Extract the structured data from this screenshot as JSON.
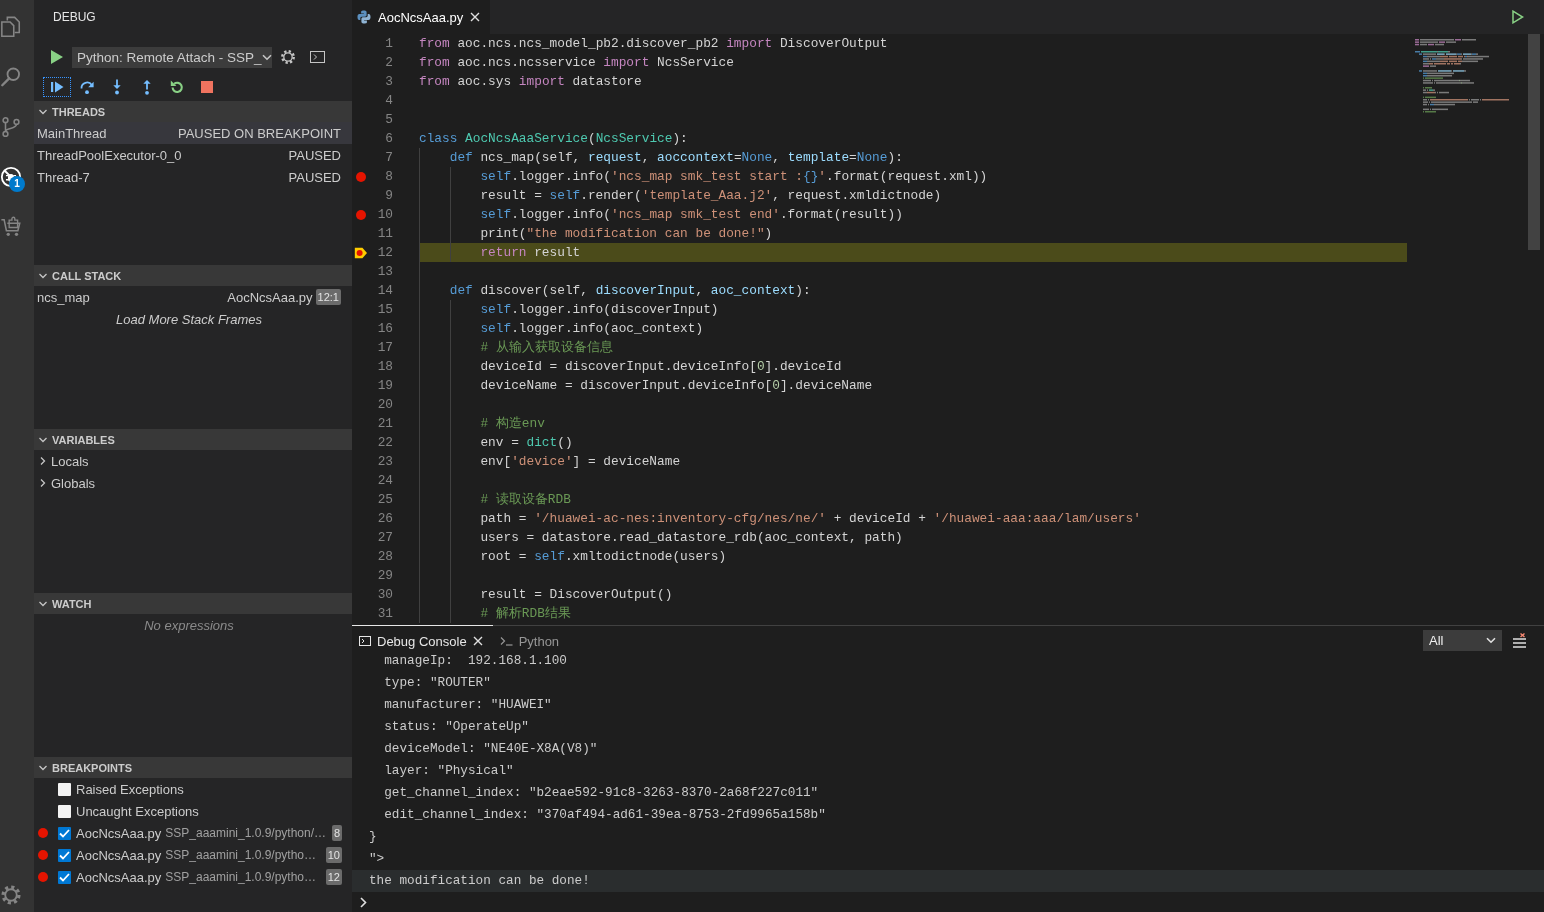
{
  "activity_bar": {
    "items": [
      {
        "kind": "explorer",
        "selected": false
      },
      {
        "kind": "search",
        "selected": false
      },
      {
        "kind": "source-control",
        "selected": false
      },
      {
        "kind": "debug",
        "selected": true,
        "badge": "1"
      },
      {
        "kind": "extensions",
        "selected": false
      }
    ],
    "bottom": [
      {
        "kind": "settings"
      }
    ]
  },
  "sidebar": {
    "title": "DEBUG",
    "config": {
      "value": "Python: Remote Attach - SSP_"
    },
    "toolbar": [
      {
        "kind": "continue",
        "focused": true
      },
      {
        "kind": "step-over",
        "focused": false
      },
      {
        "kind": "step-into",
        "focused": false
      },
      {
        "kind": "step-out",
        "focused": false
      },
      {
        "kind": "restart",
        "focused": false
      },
      {
        "kind": "stop",
        "focused": false
      }
    ],
    "sections": [
      {
        "kind": "threads",
        "title": "THREADS",
        "expanded": true,
        "threads": [
          {
            "name": "MainThread",
            "status": "PAUSED ON BREAKPOINT",
            "selected": true
          },
          {
            "name": "ThreadPoolExecutor-0_0",
            "status": "PAUSED",
            "selected": false
          },
          {
            "name": "Thread-7",
            "status": "PAUSED",
            "selected": false
          }
        ]
      },
      {
        "kind": "call-stack",
        "title": "CALL STACK",
        "expanded": true,
        "frames": [
          {
            "name": "ncs_map",
            "file": "AocNcsAaa.py",
            "position": "12:1"
          }
        ],
        "load_more": "Load More Stack Frames"
      },
      {
        "kind": "variables",
        "title": "VARIABLES",
        "expanded": true,
        "scopes": [
          {
            "label": "Locals",
            "expanded": false
          },
          {
            "label": "Globals",
            "expanded": false
          }
        ]
      },
      {
        "kind": "watch",
        "title": "WATCH",
        "expanded": true,
        "empty_message": "No expressions"
      },
      {
        "kind": "breakpoints",
        "title": "BREAKPOINTS",
        "expanded": true,
        "breakpoints": [
          {
            "kind": "exception",
            "label": "Raised Exceptions",
            "checked": false
          },
          {
            "kind": "exception",
            "label": "Uncaught Exceptions",
            "checked": false
          },
          {
            "kind": "file",
            "label": "AocNcsAaa.py",
            "path": "SSP_aaamini_1.0.9/python/…",
            "line": "8",
            "checked": true
          },
          {
            "kind": "file",
            "label": "AocNcsAaa.py",
            "path": "SSP_aaamini_1.0.9/pytho…",
            "line": "10",
            "checked": true
          },
          {
            "kind": "file",
            "label": "AocNcsAaa.py",
            "path": "SSP_aaamini_1.0.9/pytho…",
            "line": "12",
            "checked": true
          }
        ]
      }
    ]
  },
  "editor": {
    "tabs": [
      {
        "label": "AocNcsAaa.py",
        "selected": true
      }
    ],
    "lines": [
      {
        "number": "1",
        "breakpoint": false,
        "current": false,
        "tokens": [
          {
            "kind": "keyword",
            "text": "from"
          },
          {
            "kind": "plain",
            "text": " aoc.ncs.ncs_model_pb2.discover_pb2 "
          },
          {
            "kind": "keyword",
            "text": "import"
          },
          {
            "kind": "plain",
            "text": " DiscoverOutput"
          }
        ]
      },
      {
        "number": "2",
        "breakpoint": false,
        "current": false,
        "tokens": [
          {
            "kind": "keyword",
            "text": "from"
          },
          {
            "kind": "plain",
            "text": " aoc.ncs.ncsservice "
          },
          {
            "kind": "keyword",
            "text": "import"
          },
          {
            "kind": "plain",
            "text": " NcsService"
          }
        ]
      },
      {
        "number": "3",
        "breakpoint": false,
        "current": false,
        "tokens": [
          {
            "kind": "keyword",
            "text": "from"
          },
          {
            "kind": "plain",
            "text": " aoc.sys "
          },
          {
            "kind": "keyword",
            "text": "import"
          },
          {
            "kind": "plain",
            "text": " datastore"
          }
        ]
      },
      {
        "number": "4",
        "breakpoint": false,
        "current": false
      },
      {
        "number": "5",
        "breakpoint": false,
        "current": false
      },
      {
        "number": "6",
        "breakpoint": false,
        "current": false,
        "tokens": [
          {
            "kind": "storage",
            "text": "class "
          },
          {
            "kind": "type",
            "text": "AocNcsAaaService"
          },
          {
            "kind": "plain",
            "text": "("
          },
          {
            "kind": "type",
            "text": "NcsService"
          },
          {
            "kind": "plain",
            "text": "):"
          }
        ],
        "children": [
          {
            "number": "7",
            "breakpoint": false,
            "current": false,
            "tokens": [
              {
                "kind": "storage",
                "text": "def"
              },
              {
                "kind": "plain",
                "text": " ncs_map(self, "
              },
              {
                "kind": "param",
                "text": "request"
              },
              {
                "kind": "plain",
                "text": ", "
              },
              {
                "kind": "param",
                "text": "aoccontext"
              },
              {
                "kind": "plain",
                "text": "="
              },
              {
                "kind": "storage",
                "text": "None"
              },
              {
                "kind": "plain",
                "text": ", "
              },
              {
                "kind": "param",
                "text": "template"
              },
              {
                "kind": "plain",
                "text": "="
              },
              {
                "kind": "storage",
                "text": "None"
              },
              {
                "kind": "plain",
                "text": "):"
              }
            ],
            "children": [
              {
                "number": "8",
                "breakpoint": true,
                "current": false,
                "tokens": [
                  {
                    "kind": "storage",
                    "text": "self"
                  },
                  {
                    "kind": "plain",
                    "text": ".logger.info("
                  },
                  {
                    "kind": "string",
                    "text": "'ncs_map smk_test start :"
                  },
                  {
                    "kind": "format",
                    "text": "{}"
                  },
                  {
                    "kind": "string",
                    "text": "'"
                  },
                  {
                    "kind": "plain",
                    "text": ".format(request.xml))"
                  }
                ]
              },
              {
                "number": "9",
                "breakpoint": false,
                "current": false,
                "tokens": [
                  {
                    "kind": "plain",
                    "text": "result = "
                  },
                  {
                    "kind": "storage",
                    "text": "self"
                  },
                  {
                    "kind": "plain",
                    "text": ".render("
                  },
                  {
                    "kind": "string",
                    "text": "'template_Aaa.j2'"
                  },
                  {
                    "kind": "plain",
                    "text": ", request.xmldictnode)"
                  }
                ]
              },
              {
                "number": "10",
                "breakpoint": true,
                "current": false,
                "tokens": [
                  {
                    "kind": "storage",
                    "text": "self"
                  },
                  {
                    "kind": "plain",
                    "text": ".logger.info("
                  },
                  {
                    "kind": "string",
                    "text": "'ncs_map smk_test end'"
                  },
                  {
                    "kind": "plain",
                    "text": ".format(result))"
                  }
                ]
              },
              {
                "number": "11",
                "breakpoint": false,
                "current": false,
                "tokens": [
                  {
                    "kind": "plain",
                    "text": "print("
                  },
                  {
                    "kind": "string",
                    "text": "\"the modification can be done!\""
                  },
                  {
                    "kind": "plain",
                    "text": ")"
                  }
                ]
              },
              {
                "number": "12",
                "breakpoint": true,
                "current": true,
                "tokens": [
                  {
                    "kind": "keyword",
                    "text": "return"
                  },
                  {
                    "kind": "plain",
                    "text": " result"
                  }
                ]
              }
            ]
          },
          {
            "number": "13",
            "breakpoint": false,
            "current": false
          },
          {
            "number": "14",
            "breakpoint": false,
            "current": false,
            "tokens": [
              {
                "kind": "storage",
                "text": "def"
              },
              {
                "kind": "plain",
                "text": " discover(self, "
              },
              {
                "kind": "param",
                "text": "discoverInput"
              },
              {
                "kind": "plain",
                "text": ", "
              },
              {
                "kind": "param",
                "text": "aoc_context"
              },
              {
                "kind": "plain",
                "text": "):"
              }
            ],
            "children": [
              {
                "number": "15",
                "breakpoint": false,
                "current": false,
                "tokens": [
                  {
                    "kind": "storage",
                    "text": "self"
                  },
                  {
                    "kind": "plain",
                    "text": ".logger.info(discoverInput)"
                  }
                ]
              },
              {
                "number": "16",
                "breakpoint": false,
                "current": false,
                "tokens": [
                  {
                    "kind": "storage",
                    "text": "self"
                  },
                  {
                    "kind": "plain",
                    "text": ".logger.info(aoc_context)"
                  }
                ]
              },
              {
                "number": "17",
                "breakpoint": false,
                "current": false,
                "tokens": [
                  {
                    "kind": "comment",
                    "text": "# 从输入获取设备信息"
                  }
                ]
              },
              {
                "number": "18",
                "breakpoint": false,
                "current": false,
                "tokens": [
                  {
                    "kind": "plain",
                    "text": "deviceId = discoverInput.deviceInfo["
                  },
                  {
                    "kind": "number",
                    "text": "0"
                  },
                  {
                    "kind": "plain",
                    "text": "].deviceId"
                  }
                ]
              },
              {
                "number": "19",
                "breakpoint": false,
                "current": false,
                "tokens": [
                  {
                    "kind": "plain",
                    "text": "deviceName = discoverInput.deviceInfo["
                  },
                  {
                    "kind": "number",
                    "text": "0"
                  },
                  {
                    "kind": "plain",
                    "text": "].deviceName"
                  }
                ]
              },
              {
                "number": "20",
                "breakpoint": false,
                "current": false
              },
              {
                "number": "21",
                "breakpoint": false,
                "current": false,
                "tokens": [
                  {
                    "kind": "comment",
                    "text": "# 构造env"
                  }
                ]
              },
              {
                "number": "22",
                "breakpoint": false,
                "current": false,
                "tokens": [
                  {
                    "kind": "plain",
                    "text": "env = "
                  },
                  {
                    "kind": "type",
                    "text": "dict"
                  },
                  {
                    "kind": "plain",
                    "text": "()"
                  }
                ]
              },
              {
                "number": "23",
                "breakpoint": false,
                "current": false,
                "tokens": [
                  {
                    "kind": "plain",
                    "text": "env["
                  },
                  {
                    "kind": "string",
                    "text": "'device'"
                  },
                  {
                    "kind": "plain",
                    "text": "] = deviceName"
                  }
                ]
              },
              {
                "number": "24",
                "breakpoint": false,
                "current": false
              },
              {
                "number": "25",
                "breakpoint": false,
                "current": false,
                "tokens": [
                  {
                    "kind": "comment",
                    "text": "# 读取设备RDB"
                  }
                ]
              },
              {
                "number": "26",
                "breakpoint": false,
                "current": false,
                "tokens": [
                  {
                    "kind": "plain",
                    "text": "path = "
                  },
                  {
                    "kind": "string",
                    "text": "'/huawei-ac-nes:inventory-cfg/nes/ne/'"
                  },
                  {
                    "kind": "plain",
                    "text": " + deviceId + "
                  },
                  {
                    "kind": "string",
                    "text": "'/huawei-aaa:aaa/lam/users'"
                  }
                ]
              },
              {
                "number": "27",
                "breakpoint": false,
                "current": false,
                "tokens": [
                  {
                    "kind": "plain",
                    "text": "users = datastore.read_datastore_rdb(aoc_context, path)"
                  }
                ]
              },
              {
                "number": "28",
                "breakpoint": false,
                "current": false,
                "tokens": [
                  {
                    "kind": "plain",
                    "text": "root = "
                  },
                  {
                    "kind": "storage",
                    "text": "self"
                  },
                  {
                    "kind": "plain",
                    "text": ".xmltodictnode(users)"
                  }
                ]
              },
              {
                "number": "29",
                "breakpoint": false,
                "current": false
              },
              {
                "number": "30",
                "breakpoint": false,
                "current": false,
                "tokens": [
                  {
                    "kind": "plain",
                    "text": "result = DiscoverOutput()"
                  }
                ]
              },
              {
                "number": "31",
                "breakpoint": false,
                "current": false,
                "tokens": [
                  {
                    "kind": "comment",
                    "text": "# 解析RDB结果"
                  }
                ]
              }
            ]
          }
        ]
      }
    ]
  },
  "panel": {
    "tabs": [
      {
        "kind": "debug-console",
        "label": "Debug Console",
        "selected": true
      },
      {
        "kind": "terminal",
        "label": "Python",
        "selected": false
      }
    ],
    "filter": {
      "value": "All"
    },
    "console": [
      {
        "text": "  manageIp:  192.168.1.100",
        "highlighted": false
      },
      {
        "text": "  type: \"ROUTER\"",
        "highlighted": false
      },
      {
        "text": "  manufacturer: \"HUAWEI\"",
        "highlighted": false
      },
      {
        "text": "  status: \"OperateUp\"",
        "highlighted": false
      },
      {
        "text": "  deviceModel: \"NE40E-X8A(V8)\"",
        "highlighted": false
      },
      {
        "text": "  layer: \"Physical\"",
        "highlighted": false
      },
      {
        "text": "  get_channel_index: \"b2eae592-91c8-3263-8370-2a68f227c011\"",
        "highlighted": false
      },
      {
        "text": "  edit_channel_index: \"370af494-ad61-39ea-8753-2fd9965a158b\"",
        "highlighted": false
      },
      {
        "text": "}",
        "highlighted": false
      },
      {
        "text": "\">",
        "highlighted": false
      },
      {
        "text": "the modification can be done!",
        "highlighted": true
      }
    ]
  }
}
